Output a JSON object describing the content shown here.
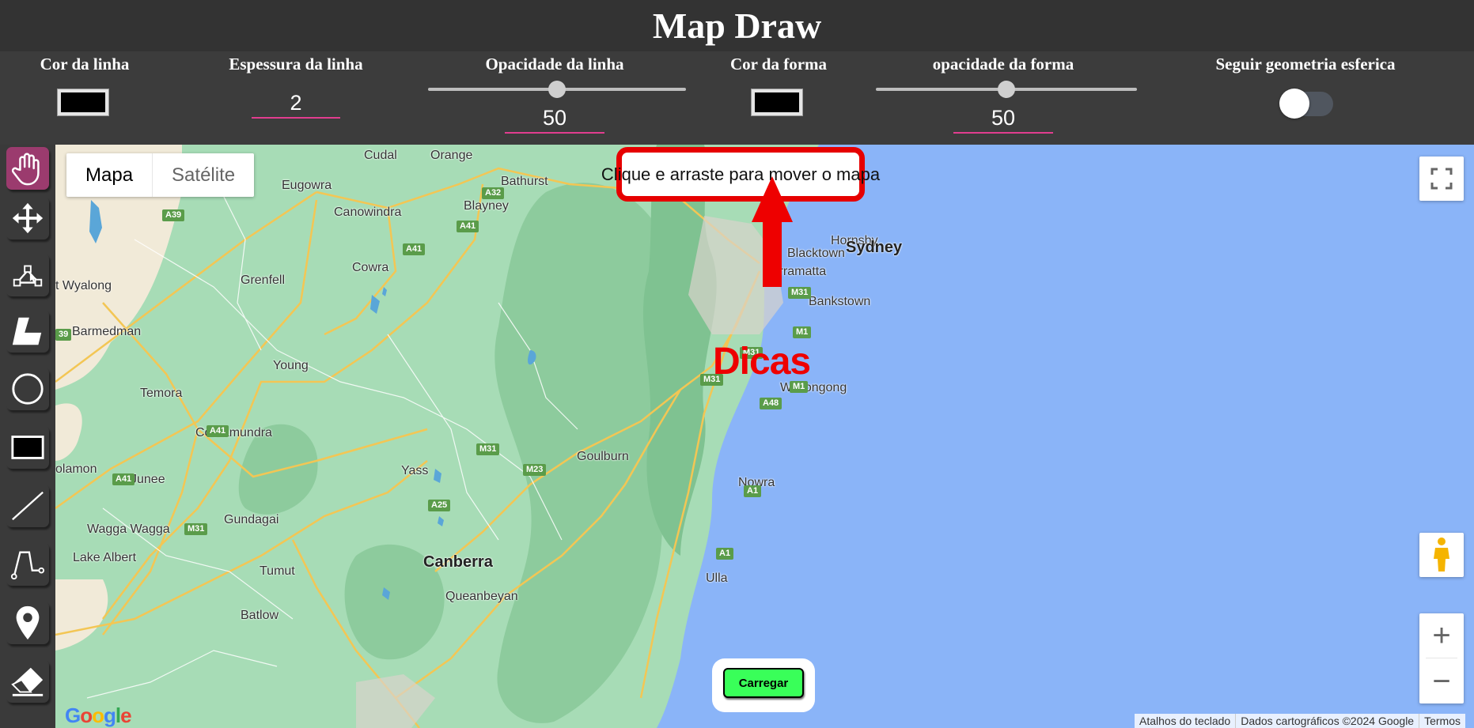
{
  "app": {
    "title": "Map Draw"
  },
  "controls": {
    "line_color": {
      "label": "Cor da linha",
      "value": "#000000"
    },
    "line_width": {
      "label": "Espessura da linha",
      "value": "2"
    },
    "line_opacity": {
      "label": "Opacidade da linha",
      "value": "50",
      "fraction": 0.5
    },
    "shape_color": {
      "label": "Cor da forma",
      "value": "#000000"
    },
    "shape_opacity": {
      "label": "opacidade da forma",
      "value": "50",
      "fraction": 0.5
    },
    "spherical": {
      "label": "Seguir geometria esferica",
      "checked": false
    }
  },
  "toolbar": {
    "tools": [
      {
        "name": "pan",
        "icon": "hand-icon",
        "active": true
      },
      {
        "name": "move",
        "icon": "move-arrows-icon"
      },
      {
        "name": "edit-vertices",
        "icon": "vertex-edit-icon"
      },
      {
        "name": "polygon",
        "icon": "polygon-icon"
      },
      {
        "name": "circle",
        "icon": "circle-icon"
      },
      {
        "name": "rectangle",
        "icon": "rectangle-icon"
      },
      {
        "name": "line",
        "icon": "line-icon"
      },
      {
        "name": "polyline",
        "icon": "polyline-icon"
      },
      {
        "name": "marker",
        "icon": "map-pin-icon"
      },
      {
        "name": "eraser",
        "icon": "eraser-icon"
      }
    ]
  },
  "map": {
    "type_buttons": {
      "map": "Mapa",
      "satellite": "Satélite"
    },
    "hint": "Clique e arraste para mover o mapa",
    "tips_label": "Dicas",
    "load_button": "Carregar",
    "zoom_in": "+",
    "zoom_out": "−",
    "attribution": {
      "shortcuts": "Atalhos do teclado",
      "data": "Dados cartográficos ©2024 Google",
      "terms": "Termos"
    },
    "logo": "Google",
    "colors": {
      "land": "#a7dcb6",
      "forest": "#8dcb9d",
      "water": "#8ab4f8",
      "dry": "#f1ead8",
      "road": "#f3c654"
    },
    "places": [
      {
        "name": "Cudal"
      },
      {
        "name": "Orange"
      },
      {
        "name": "Bathurst"
      },
      {
        "name": "Eugowra"
      },
      {
        "name": "Canowindra"
      },
      {
        "name": "Blayney"
      },
      {
        "name": "Hornsby"
      },
      {
        "name": "Blacktown"
      },
      {
        "name": "Parramatta"
      },
      {
        "name": "Sydney"
      },
      {
        "name": "Bankstown"
      },
      {
        "name": "t Wyalong"
      },
      {
        "name": "Grenfell"
      },
      {
        "name": "Cowra"
      },
      {
        "name": "Barmedman"
      },
      {
        "name": "Young"
      },
      {
        "name": "Temora"
      },
      {
        "name": "Wollongong"
      },
      {
        "name": "Cootamundra"
      },
      {
        "name": "olamon"
      },
      {
        "name": "Junee"
      },
      {
        "name": "Yass"
      },
      {
        "name": "Goulburn"
      },
      {
        "name": "Nowra"
      },
      {
        "name": "Wagga Wagga"
      },
      {
        "name": "Gundagai"
      },
      {
        "name": "Lake Albert"
      },
      {
        "name": "Tumut"
      },
      {
        "name": "Canberra"
      },
      {
        "name": "Queanbeyan"
      },
      {
        "name": "Batlow"
      },
      {
        "name": "Ulla"
      }
    ],
    "road_shields": [
      "A32",
      "A39",
      "A41",
      "A41",
      "M31",
      "M31",
      "M31",
      "M1",
      "M1",
      "A48",
      "A41",
      "M31",
      "M23",
      "A25",
      "A41",
      "M31",
      "A1",
      "A1",
      "39"
    ]
  }
}
